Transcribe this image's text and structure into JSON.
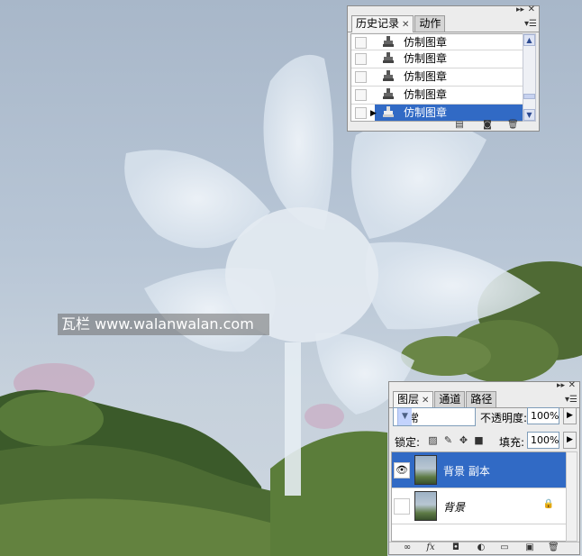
{
  "watermark": "瓦栏 www.walanwalan.com",
  "history_panel": {
    "tabs": [
      {
        "label": "历史记录",
        "active": true
      },
      {
        "label": "动作",
        "active": false
      }
    ],
    "items": [
      {
        "label": "仿制图章",
        "selected": false
      },
      {
        "label": "仿制图章",
        "selected": false
      },
      {
        "label": "仿制图章",
        "selected": false
      },
      {
        "label": "仿制图章",
        "selected": false
      },
      {
        "label": "仿制图章",
        "selected": true
      }
    ],
    "footer_icons": [
      "new-document-icon",
      "snapshot-camera-icon",
      "trash-icon"
    ]
  },
  "layers_panel": {
    "tabs": [
      {
        "label": "图层",
        "active": true
      },
      {
        "label": "通道",
        "active": false
      },
      {
        "label": "路径",
        "active": false
      }
    ],
    "blend_mode": "正常",
    "opacity_label": "不透明度:",
    "opacity_value": "100%",
    "lock_label": "锁定:",
    "fill_label": "填充:",
    "fill_value": "100%",
    "layers": [
      {
        "name": "背景 副本",
        "visible": true,
        "selected": true,
        "locked": false
      },
      {
        "name": "背景",
        "visible": false,
        "selected": false,
        "locked": true
      }
    ],
    "footer_icons": [
      "link-icon",
      "fx-icon",
      "mask-icon",
      "adjustment-icon",
      "folder-icon",
      "new-layer-icon",
      "trash-icon"
    ]
  },
  "colors": {
    "selection": "#316ac5",
    "panel_bg": "#ececec"
  }
}
